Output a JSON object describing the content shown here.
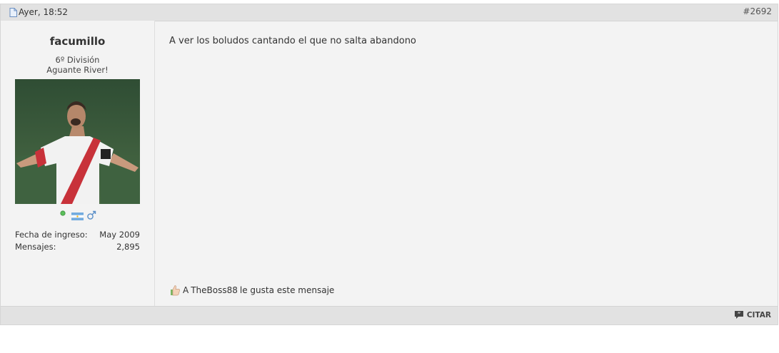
{
  "post": {
    "date": "Ayer, 18:52",
    "number": "#2692",
    "message": "A ver los boludos cantando el que no salta abandono"
  },
  "user": {
    "name": "facumillo",
    "rank": "6º División",
    "title": "Aguante River!",
    "join_label": "Fecha de ingreso:",
    "join_value": "May 2009",
    "posts_label": "Mensajes:",
    "posts_value": "2,895",
    "status_icons": [
      "online-dot-icon",
      "argentina-flag-icon",
      "male-gender-icon"
    ]
  },
  "likes": {
    "prefix": "A",
    "user": "TheBoss88",
    "suffix": "le gusta este mensaje"
  },
  "footer": {
    "quote_label": "CITAR"
  },
  "colors": {
    "header_bg": "#e2e2e2",
    "post_bg": "#f3f3f3",
    "online": "#4caf50",
    "flag_blue": "#74acdf"
  }
}
